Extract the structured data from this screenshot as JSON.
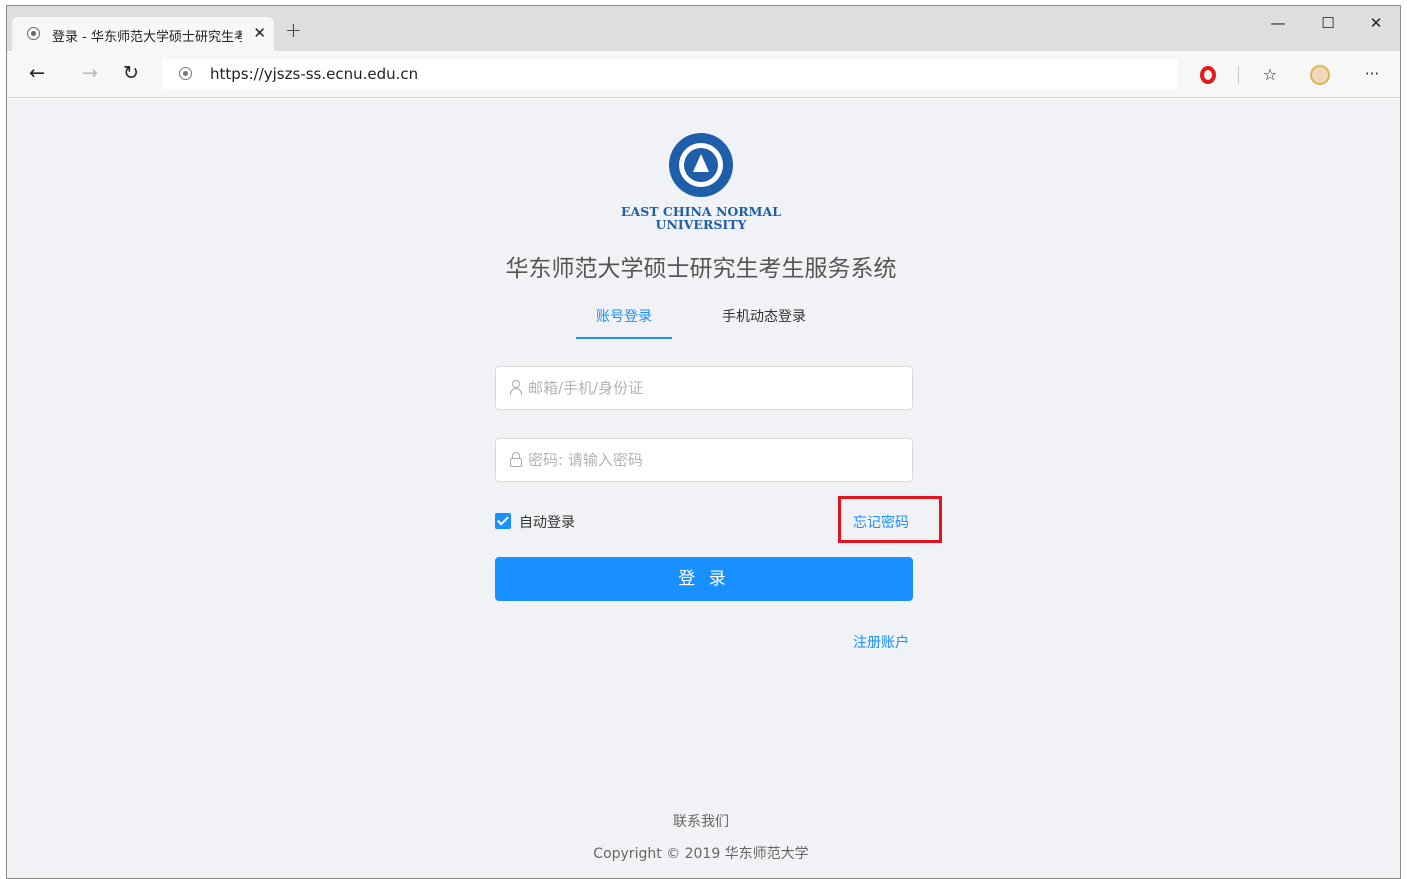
{
  "browser": {
    "tab_title": "登录 - 华东师范大学硕士研究生考",
    "tab_close": "✕",
    "new_tab": "+",
    "url": "https://yjszs-ss.ecnu.edu.cn",
    "nav_back": "←",
    "nav_forward": "→",
    "reload": "↻",
    "favorites_icon": "☆",
    "more_icon": "···",
    "window_min": "—",
    "window_max": "☐",
    "window_close": "✕"
  },
  "page": {
    "university_name_line1": "EAST CHINA NORMAL",
    "university_name_line2": "UNIVERSITY",
    "system_title": "华东师范大学硕士研究生考生服务系统",
    "tabs": [
      {
        "label": "账号登录",
        "active": true
      },
      {
        "label": "手机动态登录",
        "active": false
      }
    ],
    "username_placeholder": "邮箱/手机/身份证",
    "password_placeholder": "密码: 请输入密码",
    "remember_label": "自动登录",
    "remember_checked": true,
    "forgot_label": "忘记密码",
    "login_button": "登 录",
    "register_label": "注册账户",
    "footer_contact": "联系我们",
    "footer_copyright": "Copyright © 2019 华东师范大学"
  },
  "colors": {
    "accent": "#1890ff",
    "highlight_box": "#e3141e",
    "logo_blue": "#1f5fa9",
    "page_bg": "#f0f2f5"
  }
}
